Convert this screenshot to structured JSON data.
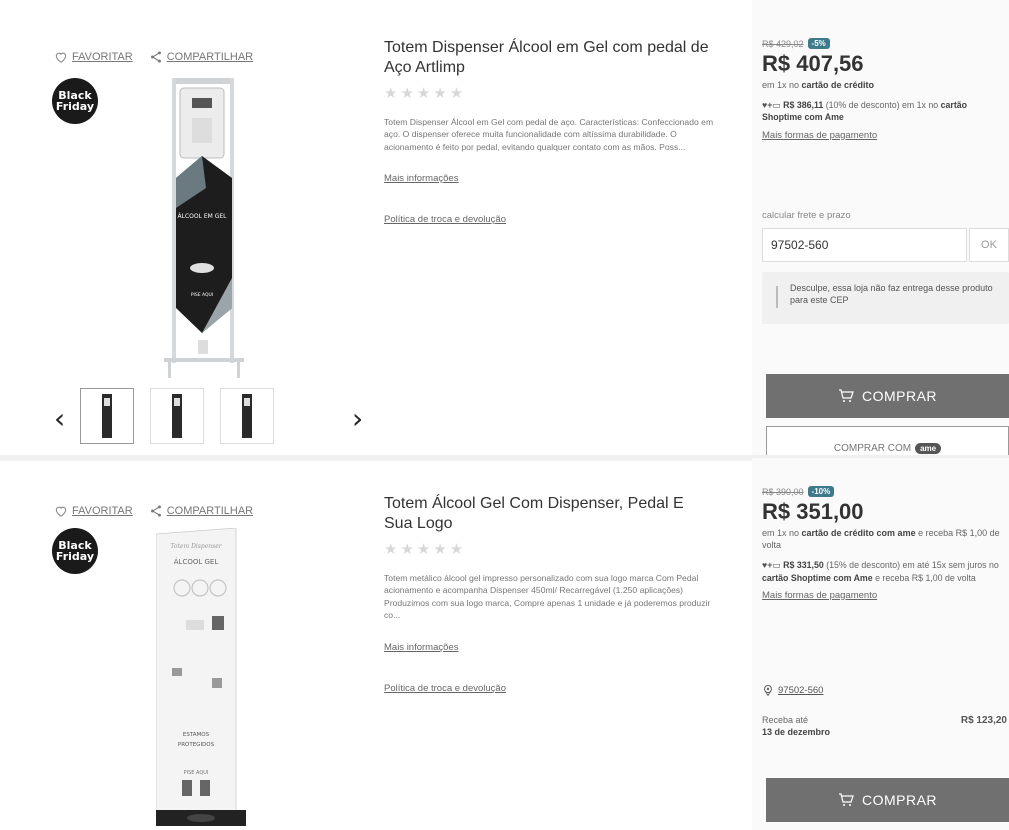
{
  "actions": {
    "favorite": "FAVORITAR",
    "share": "COMPARTILHAR"
  },
  "badge": {
    "line1": "Black",
    "line2": "Friday"
  },
  "products": [
    {
      "title": "Totem Dispenser Álcool em Gel com pedal de Aço Artlimp",
      "stars": "★★★★★",
      "description": "Totem Dispenser Álcool em Gel com pedal de aço. Características: Confeccionado em aço. O dispenser oferece muita funcionalidade com altíssima durabilidade. O acionamento é feito por pedal, evitando qualquer contato com as mãos. Poss...",
      "more_info": "Mais informações",
      "policy": "Política de troca e devolução",
      "old_price": "R$ 429,02",
      "discount": "-5%",
      "price": "R$ 407,56",
      "pay_prefix": "em 1x no ",
      "pay_bold": "cartão de crédito",
      "pay_suffix": "",
      "ame_logo": "♥+▭",
      "ame_price": "R$ 386,11",
      "ame_mid": " (10% de desconto) em 1x no ",
      "ame_bold": "cartão Shoptime com Ame",
      "more_pay": "Mais formas de pagamento",
      "freight_label": "calcular frete e prazo",
      "cep_value": "97502-560",
      "ok_label": "OK",
      "notice": "Desculpe, essa loja não faz entrega desse produto para este CEP",
      "buy_label": "COMPRAR",
      "buy_ame_label": "COMPRAR COM",
      "buy_ame_pill": "ame"
    },
    {
      "title": "Totem Álcool Gel Com Dispenser, Pedal E Sua Logo",
      "stars": "★★★★★",
      "description": "Totem metálico álcool gel impresso personalizado com sua logo marca Com Pedal acionamento e acompanha Dispenser 450ml/ Recarregável (1.250 aplicações) Produzimos com sua logo marca, Compre apenas 1 unidade e já poderemos produzir co...",
      "more_info": "Mais informações",
      "policy": "Política de troca e devolução",
      "old_price": "R$ 390,00",
      "discount": "-10%",
      "price": "R$ 351,00",
      "pay_prefix": "em 1x no ",
      "pay_bold": "cartão de crédito com ame",
      "pay_suffix": " e receba R$ 1,00 de volta",
      "ame_logo": "♥+▭",
      "ame_price": "R$ 331,50",
      "ame_mid": " (15% de desconto) em até 15x sem juros no ",
      "ame_bold": "cartão Shoptime com Ame",
      "ame_suffix": " e receba R$ 1,00 de volta",
      "more_pay": "Mais formas de pagamento",
      "cep_value": "97502-560",
      "delivery_label": "Receba até",
      "delivery_date": "13 de dezembro",
      "delivery_price": "R$ 123,20",
      "buy_label": "COMPRAR"
    }
  ]
}
